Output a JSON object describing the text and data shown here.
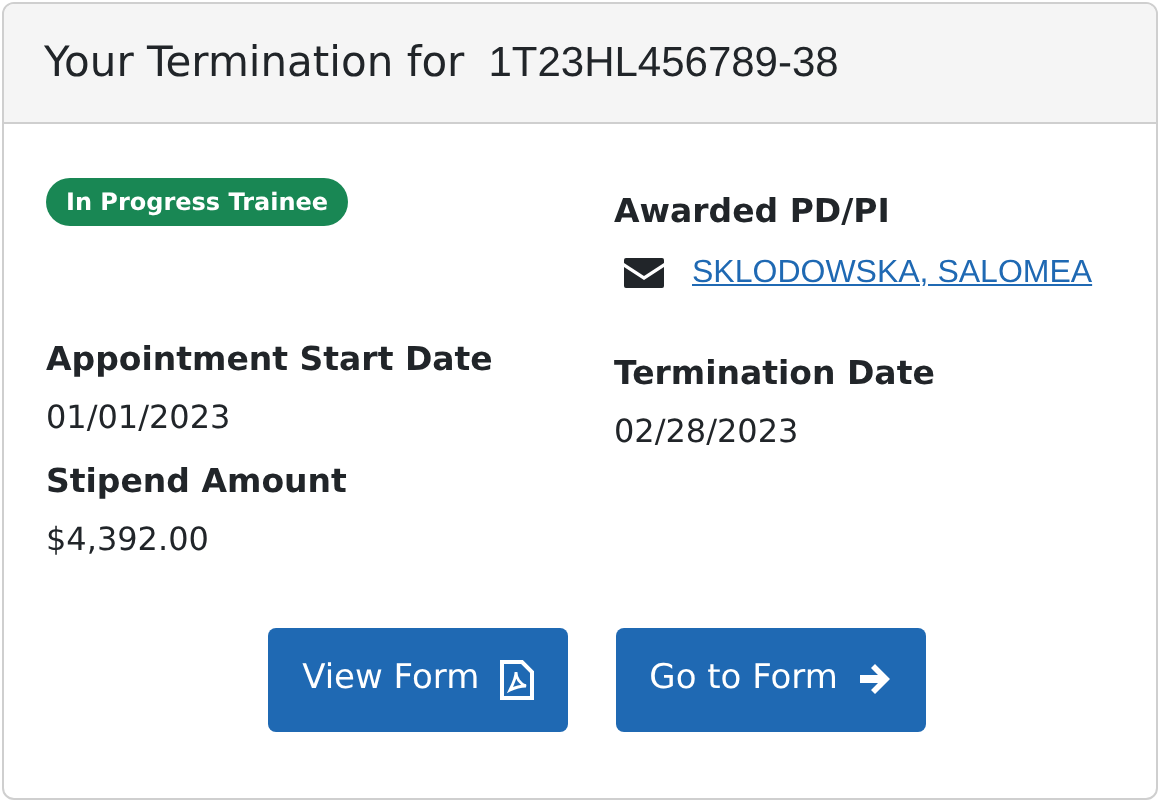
{
  "header": {
    "title": "Your Termination for",
    "grant_number": "1T23HL456789-38"
  },
  "status_badge": {
    "text": "In Progress Trainee",
    "color": "#198754"
  },
  "awarded_pd_pi": {
    "label": "Awarded PD/PI",
    "name": "SKLODOWSKA, SALOMEA"
  },
  "left_fields": [
    {
      "label": "Appointment Start Date",
      "value": "01/01/2023"
    },
    {
      "label": "Stipend Amount",
      "value": "$4,392.00"
    }
  ],
  "right_fields": [
    {
      "label": "Termination Date",
      "value": "02/28/2023"
    }
  ],
  "buttons": [
    {
      "label": "View Form",
      "kind": "pdf"
    },
    {
      "label": "Go to Form",
      "kind": "arrow"
    }
  ]
}
